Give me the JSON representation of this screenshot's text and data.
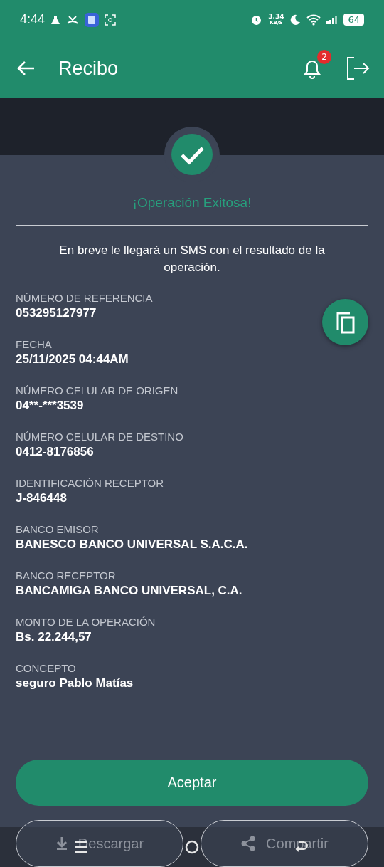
{
  "status_bar": {
    "time": "4:44",
    "speed": "3.34",
    "speed_unit": "KB/S",
    "battery": "64"
  },
  "header": {
    "title": "Recibo",
    "notifications": "2"
  },
  "result": {
    "title": "¡Operación Exitosa!",
    "message": "En breve le llegará un SMS con el resultado de la operación."
  },
  "fields": [
    {
      "label": "NÚMERO DE REFERENCIA",
      "value": "053295127977"
    },
    {
      "label": "FECHA",
      "value": "25/11/2025 04:44AM"
    },
    {
      "label": "NÚMERO CELULAR DE ORIGEN",
      "value": "04**-***3539"
    },
    {
      "label": "NÚMERO CELULAR DE DESTINO",
      "value": "0412-8176856"
    },
    {
      "label": "IDENTIFICACIÓN RECEPTOR",
      "value": "J-846448"
    },
    {
      "label": "BANCO EMISOR",
      "value": "BANESCO BANCO UNIVERSAL S.A.C.A."
    },
    {
      "label": "BANCO RECEPTOR",
      "value": "BANCAMIGA BANCO UNIVERSAL, C.A."
    },
    {
      "label": "MONTO DE LA OPERACIÓN",
      "value": "Bs. 22.244,57"
    },
    {
      "label": "CONCEPTO",
      "value": "seguro Pablo Matías"
    }
  ],
  "buttons": {
    "accept": "Aceptar",
    "download": "Descargar",
    "share": "Compartir"
  }
}
